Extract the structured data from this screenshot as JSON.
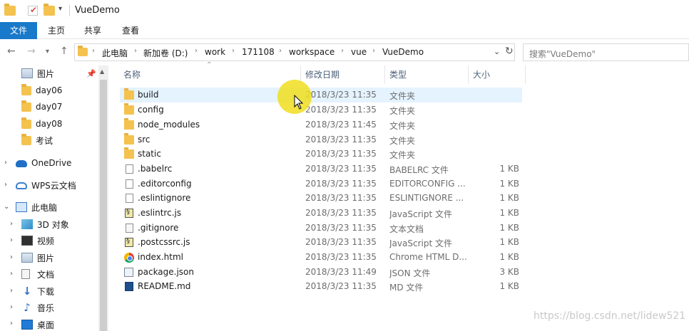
{
  "window": {
    "title": "VueDemo"
  },
  "ribbon": {
    "tabs": [
      "文件",
      "主页",
      "共享",
      "查看"
    ]
  },
  "address": {
    "crumbs": [
      "此电脑",
      "新加卷 (D:)",
      "work",
      "171108",
      "workspace",
      "vue",
      "VueDemo"
    ],
    "search_placeholder": "搜索\"VueDemo\""
  },
  "sidebar": {
    "items": [
      {
        "label": "图片",
        "icon": "pictures-icon",
        "pinned": true
      },
      {
        "label": "day06",
        "icon": "folder-icon"
      },
      {
        "label": "day07",
        "icon": "folder-icon"
      },
      {
        "label": "day08",
        "icon": "folder-icon"
      },
      {
        "label": "考试",
        "icon": "folder-icon"
      },
      {
        "label": "OneDrive",
        "icon": "onedrive-icon"
      },
      {
        "label": "WPS云文档",
        "icon": "wps-cloud-icon"
      },
      {
        "label": "此电脑",
        "icon": "this-pc-icon"
      },
      {
        "label": "3D 对象",
        "icon": "3d-objects-icon"
      },
      {
        "label": "视频",
        "icon": "video-icon"
      },
      {
        "label": "图片",
        "icon": "pictures-icon"
      },
      {
        "label": "文档",
        "icon": "documents-icon"
      },
      {
        "label": "下载",
        "icon": "download-icon"
      },
      {
        "label": "音乐",
        "icon": "music-icon"
      },
      {
        "label": "桌面",
        "icon": "desktop-icon"
      }
    ]
  },
  "columns": {
    "name": "名称",
    "date": "修改日期",
    "type": "类型",
    "size": "大小"
  },
  "files": [
    {
      "name": "build",
      "date": "2018/3/23 11:35",
      "type": "文件夹",
      "size": "",
      "icon": "folder-icon",
      "selected": true
    },
    {
      "name": "config",
      "date": "2018/3/23 11:35",
      "type": "文件夹",
      "size": "",
      "icon": "folder-icon"
    },
    {
      "name": "node_modules",
      "date": "2018/3/23 11:45",
      "type": "文件夹",
      "size": "",
      "icon": "folder-icon"
    },
    {
      "name": "src",
      "date": "2018/3/23 11:35",
      "type": "文件夹",
      "size": "",
      "icon": "folder-icon"
    },
    {
      "name": "static",
      "date": "2018/3/23 11:35",
      "type": "文件夹",
      "size": "",
      "icon": "folder-icon"
    },
    {
      "name": ".babelrc",
      "date": "2018/3/23 11:35",
      "type": "BABELRC 文件",
      "size": "1 KB",
      "icon": "file-icon"
    },
    {
      "name": ".editorconfig",
      "date": "2018/3/23 11:35",
      "type": "EDITORCONFIG ...",
      "size": "1 KB",
      "icon": "file-icon"
    },
    {
      "name": ".eslintignore",
      "date": "2018/3/23 11:35",
      "type": "ESLINTIGNORE ...",
      "size": "1 KB",
      "icon": "file-icon"
    },
    {
      "name": ".eslintrc.js",
      "date": "2018/3/23 11:35",
      "type": "JavaScript 文件",
      "size": "1 KB",
      "icon": "js-file-icon"
    },
    {
      "name": ".gitignore",
      "date": "2018/3/23 11:35",
      "type": "文本文档",
      "size": "1 KB",
      "icon": "text-file-icon"
    },
    {
      "name": ".postcssrc.js",
      "date": "2018/3/23 11:35",
      "type": "JavaScript 文件",
      "size": "1 KB",
      "icon": "js-file-icon"
    },
    {
      "name": "index.html",
      "date": "2018/3/23 11:35",
      "type": "Chrome HTML D...",
      "size": "1 KB",
      "icon": "chrome-icon"
    },
    {
      "name": "package.json",
      "date": "2018/3/23 11:49",
      "type": "JSON 文件",
      "size": "3 KB",
      "icon": "json-file-icon"
    },
    {
      "name": "README.md",
      "date": "2018/3/23 11:35",
      "type": "MD 文件",
      "size": "1 KB",
      "icon": "md-file-icon"
    }
  ],
  "watermark": "https://blog.csdn.net/lidew521",
  "colors": {
    "accent": "#1979ca",
    "selection": "#e5f3ff",
    "folder": "#f4c24f"
  }
}
